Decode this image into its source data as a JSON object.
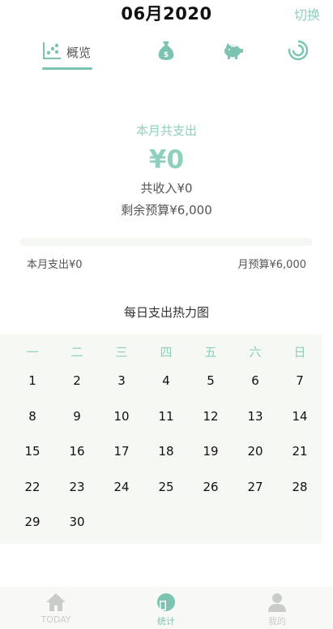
{
  "header": {
    "title": "06月2020",
    "switch_label": "切换"
  },
  "tabs": [
    {
      "name": "overview",
      "label": "概览"
    },
    {
      "name": "money-bag"
    },
    {
      "name": "piggy-bank"
    },
    {
      "name": "ring-chart"
    }
  ],
  "summary": {
    "label": "本月共支出",
    "amount": "¥0",
    "income": "共收入¥0",
    "remaining": "剩余预算¥6,000"
  },
  "budget": {
    "spent_label": "本月支出¥0",
    "budget_label": "月预算¥6,000",
    "progress_fraction": 0
  },
  "heatmap": {
    "title": "每日支出热力图",
    "weekdays": [
      "一",
      "二",
      "三",
      "四",
      "五",
      "六",
      "日"
    ],
    "days": [
      "1",
      "2",
      "3",
      "4",
      "5",
      "6",
      "7",
      "8",
      "9",
      "10",
      "11",
      "12",
      "13",
      "14",
      "15",
      "16",
      "17",
      "18",
      "19",
      "20",
      "21",
      "22",
      "23",
      "24",
      "25",
      "26",
      "27",
      "28",
      "29",
      "30"
    ]
  },
  "tabbar": {
    "items": [
      {
        "label": "TODAY",
        "icon": "home-icon"
      },
      {
        "label": "统计",
        "icon": "stats-icon"
      },
      {
        "label": "我的",
        "icon": "user-icon"
      }
    ]
  },
  "colors": {
    "accent": "#8fcfbe",
    "inactive": "#c9cdc8"
  }
}
